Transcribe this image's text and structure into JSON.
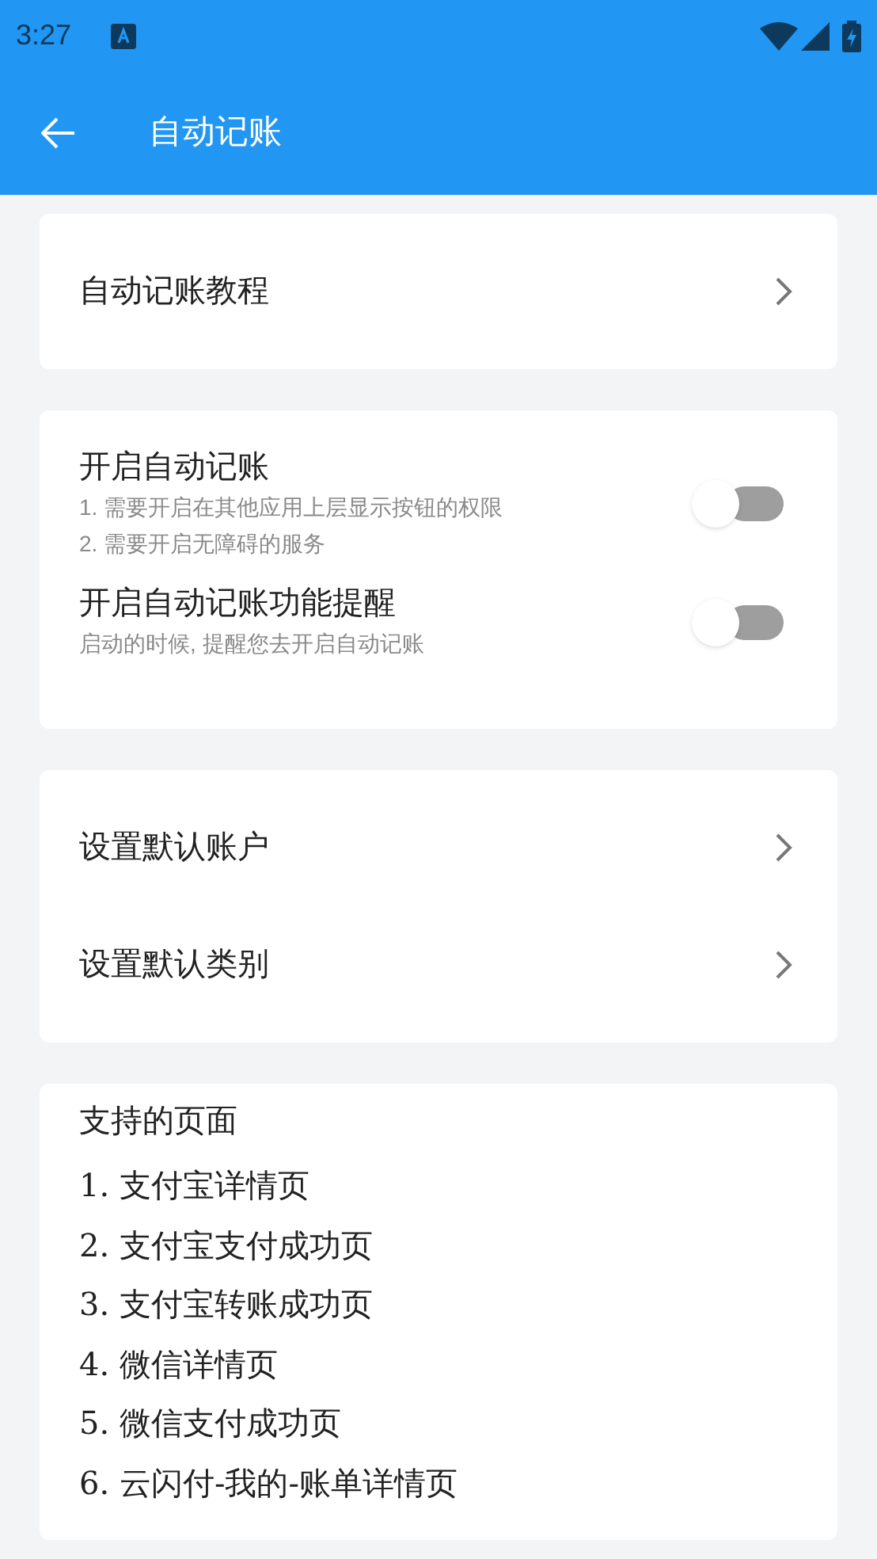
{
  "status_bar": {
    "time": "3:27"
  },
  "app_bar": {
    "title": "自动记账"
  },
  "tutorial": {
    "label": "自动记账教程"
  },
  "switches": [
    {
      "title": "开启自动记账",
      "notes": [
        "1. 需要开启在其他应用上层显示按钮的权限",
        "2. 需要开启无障碍的服务"
      ],
      "on": false
    },
    {
      "title": "开启自动记账功能提醒",
      "notes": [
        "启动的时候, 提醒您去开启自动记账"
      ],
      "on": false
    }
  ],
  "defaults": [
    {
      "label": "设置默认账户"
    },
    {
      "label": "设置默认类别"
    }
  ],
  "supported_pages": {
    "title": "支持的页面",
    "items": [
      "1. 支付宝详情页",
      "2. 支付宝支付成功页",
      "3. 支付宝转账成功页",
      "4. 微信详情页",
      "5. 微信支付成功页",
      "6. 云闪付-我的-账单详情页"
    ]
  }
}
